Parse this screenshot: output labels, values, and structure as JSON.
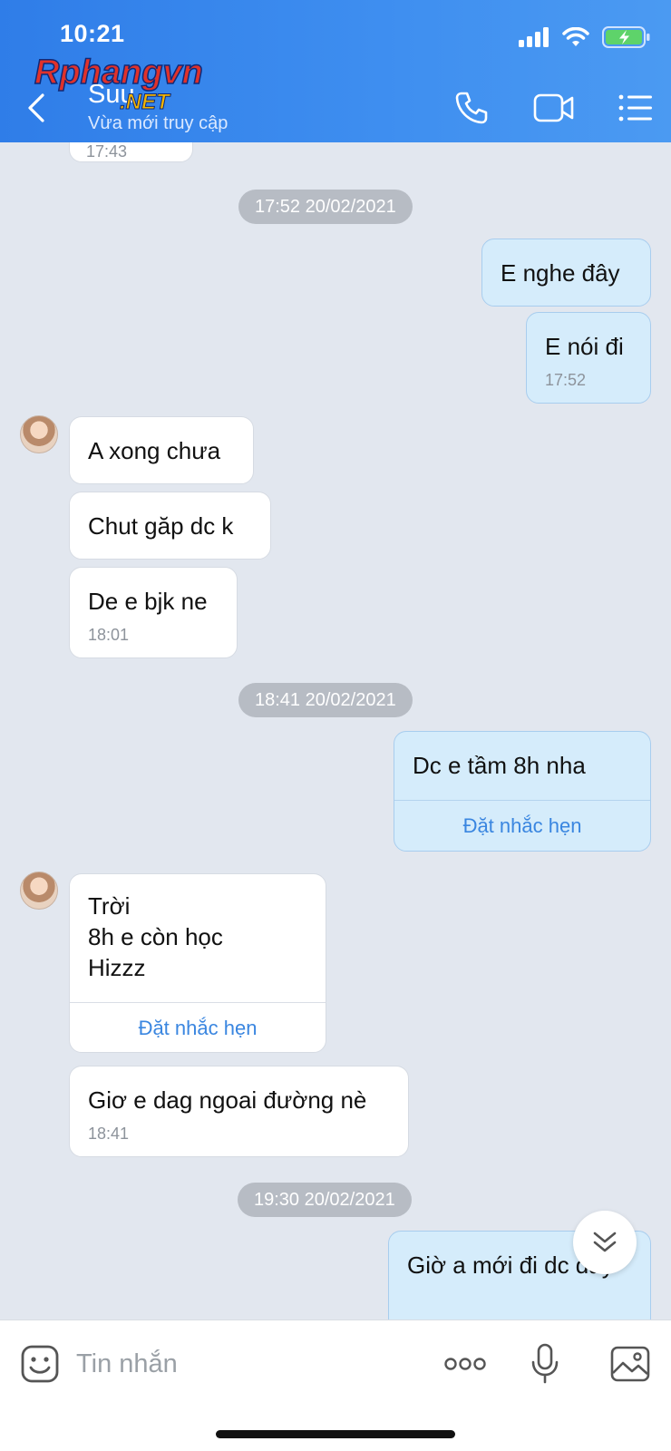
{
  "status_bar": {
    "time": "10:21"
  },
  "header": {
    "contact_name": "Suu",
    "contact_status": "Vừa mới truy cập",
    "watermark_text": "Rphangvn",
    "watermark_sub": ".NET"
  },
  "chat": {
    "partial_top_time": "17:43",
    "separators": [
      "17:52 20/02/2021",
      "18:41 20/02/2021",
      "19:30 20/02/2021"
    ],
    "messages": [
      {
        "text": "E nghe đây"
      },
      {
        "text": "E nói đi",
        "time": "17:52"
      },
      {
        "text": "A xong chưa"
      },
      {
        "text": "Chut găp dc k"
      },
      {
        "text": "De e bjk ne",
        "time": "18:01"
      },
      {
        "text": "Dc e tầm 8h nha",
        "action": "Đặt nhắc hẹn"
      },
      {
        "lines": [
          "Trời",
          "8h e còn học",
          "Hizzz"
        ],
        "action": "Đặt nhắc hẹn"
      },
      {
        "text": "Giơ e dag ngoai đường nè",
        "time": "18:41"
      },
      {
        "text": "Giờ a mới đi dc đây"
      }
    ]
  },
  "input_bar": {
    "placeholder": "Tin nhắn"
  },
  "colors": {
    "header_blue": "#3a88ee",
    "outgoing_bubble": "#d5ecfb",
    "chat_bg": "#e2e7ef",
    "link_blue": "#3a86e0"
  }
}
